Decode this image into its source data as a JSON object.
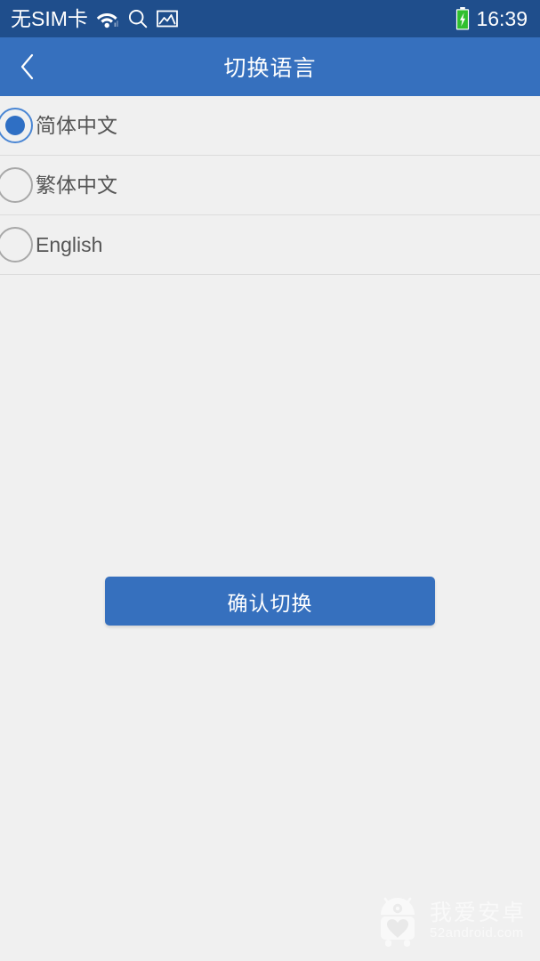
{
  "statusbar": {
    "carrier": "无SIM卡",
    "time": "16:39",
    "icons": [
      "wifi-icon",
      "search-icon",
      "image-icon",
      "battery-charging-icon"
    ],
    "background_color": "#1f4e8c",
    "text_color": "#ffffff"
  },
  "titlebar": {
    "title": "切换语言",
    "back_icon": "chevron-left-icon",
    "background_color": "#3670be",
    "text_color": "#ffffff"
  },
  "language_list": {
    "options": [
      {
        "label": "简体中文",
        "selected": true
      },
      {
        "label": "繁体中文",
        "selected": false
      },
      {
        "label": "English",
        "selected": false
      }
    ],
    "selected_color": "#2f6fc4",
    "label_color": "#555555",
    "divider_color": "#dcdcdc"
  },
  "confirm": {
    "label": "确认切换",
    "background_color": "#3670be",
    "text_color": "#ffffff"
  },
  "watermark": {
    "name_cn": "我爱安卓",
    "url": "52android.com",
    "logo_icon": "android-robot-icon"
  },
  "page": {
    "background_color": "#f0f0f0"
  }
}
